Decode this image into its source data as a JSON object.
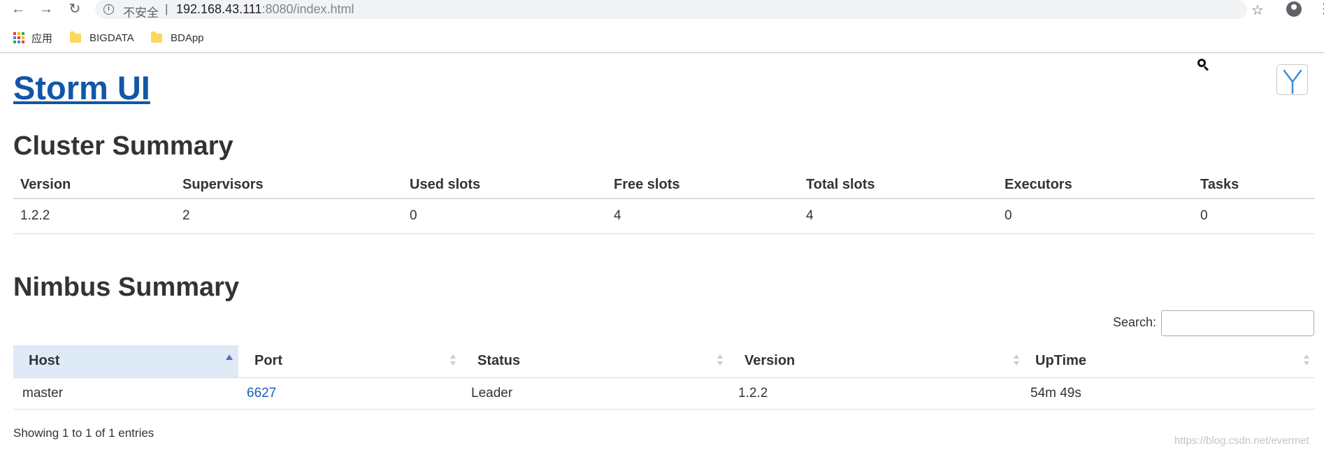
{
  "browser": {
    "insecure_label": "不安全",
    "separator": "|",
    "url_host": "192.168.43.111",
    "url_rest": ":8080/index.html",
    "bookmarks": [
      {
        "label": "应用"
      },
      {
        "label": "BIGDATA"
      },
      {
        "label": "BDApp"
      }
    ],
    "apps_colors": [
      "#ea4335",
      "#fbbc05",
      "#34a853",
      "#4285f4",
      "#ea4335",
      "#fbbc05",
      "#34a853",
      "#4285f4",
      "#ea4335"
    ]
  },
  "page": {
    "title": "Storm UI",
    "accent_color": "#1256a8"
  },
  "cluster": {
    "heading": "Cluster Summary",
    "columns": [
      "Version",
      "Supervisors",
      "Used slots",
      "Free slots",
      "Total slots",
      "Executors",
      "Tasks"
    ],
    "rows": [
      [
        "1.2.2",
        "2",
        "0",
        "4",
        "4",
        "0",
        "0"
      ]
    ]
  },
  "nimbus": {
    "heading": "Nimbus Summary",
    "search_label": "Search:",
    "search_value": "",
    "columns": [
      "Host",
      "Port",
      "Status",
      "Version",
      "UpTime"
    ],
    "sorted_column": "Host",
    "sort_direction": "ascending",
    "rows": [
      {
        "host": "master",
        "port": "6627",
        "status": "Leader",
        "version": "1.2.2",
        "uptime": "54m 49s"
      }
    ],
    "info": "Showing 1 to 1 of 1 entries"
  },
  "watermark": "https://blog.csdn.net/evermet"
}
